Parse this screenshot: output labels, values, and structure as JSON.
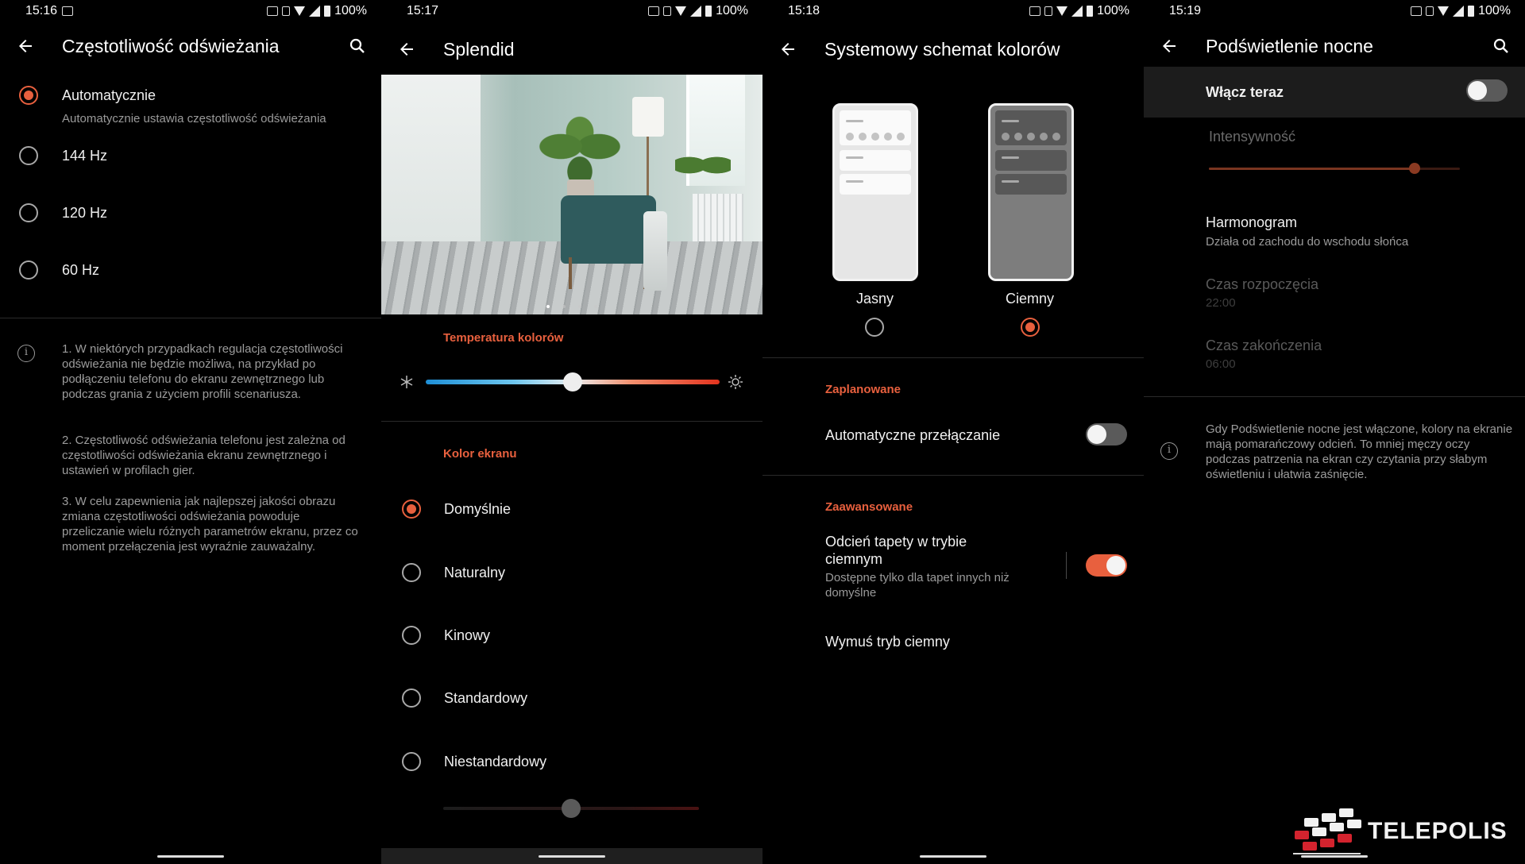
{
  "screens": [
    {
      "status": {
        "time": "15:16",
        "battery": "100%"
      },
      "title": "Częstotliwość odświeżania",
      "options": [
        {
          "label": "Automatycznie",
          "desc": "Automatycznie ustawia częstotliwość odświeżania",
          "selected": true
        },
        {
          "label": "144 Hz",
          "selected": false
        },
        {
          "label": "120 Hz",
          "selected": false
        },
        {
          "label": "60 Hz",
          "selected": false
        }
      ],
      "notes": [
        "1. W niektórych przypadkach regulacja częstotliwości odświeżania nie będzie możliwa, na przykład po podłączeniu telefonu do ekranu zewnętrznego lub podczas grania z użyciem profili scenariusza.",
        "2. Częstotliwość odświeżania telefonu jest zależna od częstotliwości odświeżania ekranu zewnętrznego i ustawień w profilach gier.",
        "3. W celu zapewnienia jak najlepszej jakości obrazu zmiana częstotliwości odświeżania powoduje przeliczanie wielu różnych parametrów ekranu, przez co moment przełączenia jest wyraźnie zauważalny."
      ]
    },
    {
      "status": {
        "time": "15:17",
        "battery": "100%"
      },
      "title": "Splendid",
      "color_temp_label": "Temperatura kolorów",
      "color_temp_value": 0.5,
      "screen_color_label": "Kolor ekranu",
      "options": [
        {
          "label": "Domyślnie",
          "selected": true
        },
        {
          "label": "Naturalny",
          "selected": false
        },
        {
          "label": "Kinowy",
          "selected": false
        },
        {
          "label": "Standardowy",
          "selected": false
        },
        {
          "label": "Niestandardowy",
          "selected": false
        }
      ],
      "custom_slider_value": 0.5
    },
    {
      "status": {
        "time": "15:18",
        "battery": "100%"
      },
      "title": "Systemowy schemat kolorów",
      "themes": [
        {
          "label": "Jasny",
          "selected": false
        },
        {
          "label": "Ciemny",
          "selected": true
        }
      ],
      "scheduled_header": "Zaplanowane",
      "auto_switch_label": "Automatyczne przełączanie",
      "auto_switch_on": false,
      "advanced_header": "Zaawansowane",
      "wallpaper_tint_title": "Odcień tapety w trybie ciemnym",
      "wallpaper_tint_desc": "Dostępne tylko dla tapet innych niż domyślne",
      "wallpaper_tint_on": true,
      "force_dark_label": "Wymuś tryb ciemny"
    },
    {
      "status": {
        "time": "15:19",
        "battery": "100%"
      },
      "title": "Podświetlenie nocne",
      "turn_on_label": "Włącz teraz",
      "turn_on_enabled": false,
      "intensity_label": "Intensywność",
      "intensity_value": 0.82,
      "schedule_label": "Harmonogram",
      "schedule_value": "Działa od zachodu do wschodu słońca",
      "start_label": "Czas rozpoczęcia",
      "start_value": "22:00",
      "end_label": "Czas zakończenia",
      "end_value": "06:00",
      "info_text": "Gdy Podświetlenie nocne jest włączone, kolory na ekranie mają pomarańczowy odcień. To mniej męczy oczy podczas patrzenia na ekran czy czytania przy słabym oświetleniu i ułatwia zaśnięcie."
    }
  ],
  "logo": {
    "text": "TELEPOLIS"
  },
  "colors": {
    "accent": "#e8603e",
    "background": "#000000",
    "logo_red": "#d3232e"
  }
}
